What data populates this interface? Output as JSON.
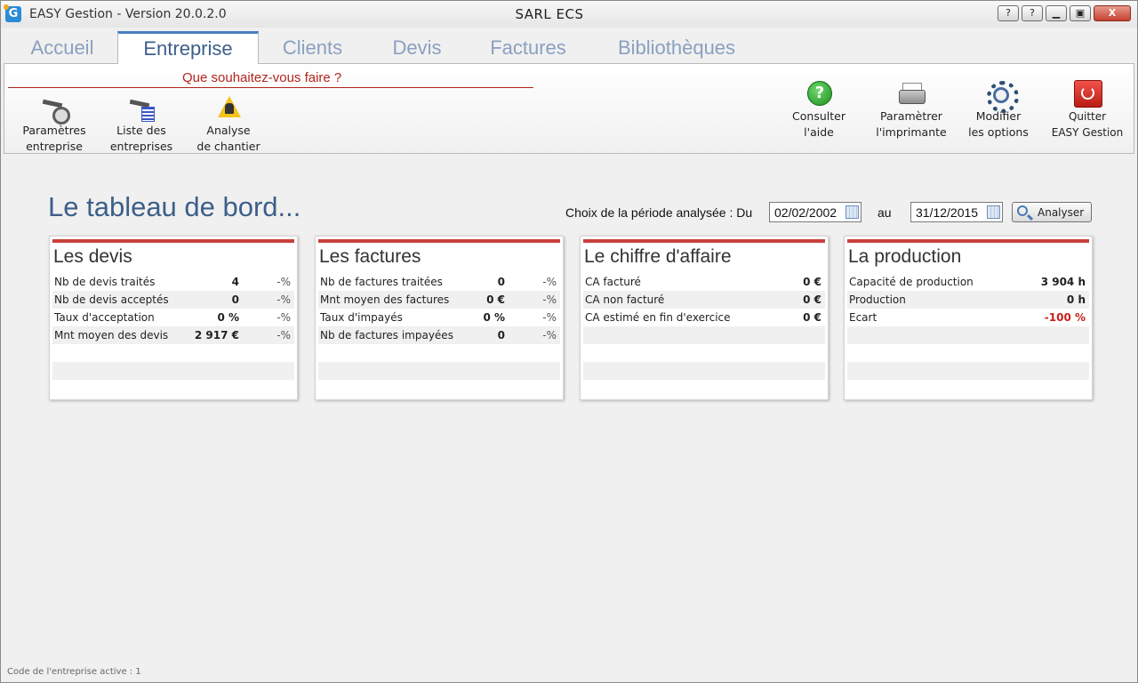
{
  "window": {
    "app_title": "EASY Gestion - Version 20.0.2.0",
    "company": "SARL ECS",
    "app_icon_letter": "G",
    "buttons": {
      "extra": "?",
      "help": "?",
      "minimize": "▁",
      "maximize": "▣",
      "close": "X"
    }
  },
  "tabs": [
    {
      "label": "Accueil",
      "active": false
    },
    {
      "label": "Entreprise",
      "active": true
    },
    {
      "label": "Clients",
      "active": false
    },
    {
      "label": "Devis",
      "active": false
    },
    {
      "label": "Factures",
      "active": false
    },
    {
      "label": "Bibliothèques",
      "active": false
    }
  ],
  "ribbon": {
    "title": "Que souhaitez-vous faire ?",
    "left_buttons": [
      {
        "label": "Paramètres\nentreprise",
        "icon": "company-settings-icon"
      },
      {
        "label": "Liste des\nentreprises",
        "icon": "company-list-icon"
      },
      {
        "label": "Analyse\nde chantier",
        "icon": "site-analysis-icon"
      }
    ],
    "right_buttons": [
      {
        "label": "Consulter\nl'aide",
        "icon": "help-icon"
      },
      {
        "label": "Paramètrer\nl'imprimante",
        "icon": "printer-icon"
      },
      {
        "label": "Modifier\nles options",
        "icon": "gear-icon"
      },
      {
        "label": "Quitter\nEASY Gestion",
        "icon": "power-icon"
      }
    ]
  },
  "dashboard": {
    "title": "Le tableau de bord...",
    "period_label": "Choix de la période analysée : Du",
    "date_from": "02/02/2002",
    "to_label": "au",
    "date_to": "31/12/2015",
    "analyse_button": "Analyser"
  },
  "cards": {
    "devis": {
      "title": "Les devis",
      "rows": [
        {
          "label": "Nb de devis traités",
          "value": "4",
          "pct": "-%"
        },
        {
          "label": "Nb de devis acceptés",
          "value": "0",
          "pct": "-%"
        },
        {
          "label": "Taux d'acceptation",
          "value": "0 %",
          "pct": "-%"
        },
        {
          "label": "Mnt moyen des devis",
          "value": "2 917 €",
          "pct": "-%"
        }
      ]
    },
    "factures": {
      "title": "Les factures",
      "rows": [
        {
          "label": "Nb de factures traitées",
          "value": "0",
          "pct": "-%"
        },
        {
          "label": "Mnt moyen des factures",
          "value": "0 €",
          "pct": "-%"
        },
        {
          "label": "Taux d'impayés",
          "value": "0 %",
          "pct": "-%"
        },
        {
          "label": "Nb de factures impayées",
          "value": "0",
          "pct": "-%"
        }
      ]
    },
    "ca": {
      "title": "Le chiffre d'affaire",
      "rows": [
        {
          "label": "CA facturé",
          "value": "0 €"
        },
        {
          "label": "CA non facturé",
          "value": "0 €"
        },
        {
          "label": "CA estimé en fin d'exercice",
          "value": "0 €"
        }
      ]
    },
    "production": {
      "title": "La production",
      "rows": [
        {
          "label": "Capacité de production",
          "value": "3 904 h"
        },
        {
          "label": "Production",
          "value": "0 h"
        },
        {
          "label": "Ecart",
          "value": "-100 %"
        }
      ]
    }
  },
  "footer": {
    "text": "Code de l'entreprise active : 1"
  },
  "colors": {
    "accent": "#3c5f8a",
    "card_bar": "#c9403b",
    "ribbon_title": "#b3251d",
    "negative": "#c9201a"
  }
}
